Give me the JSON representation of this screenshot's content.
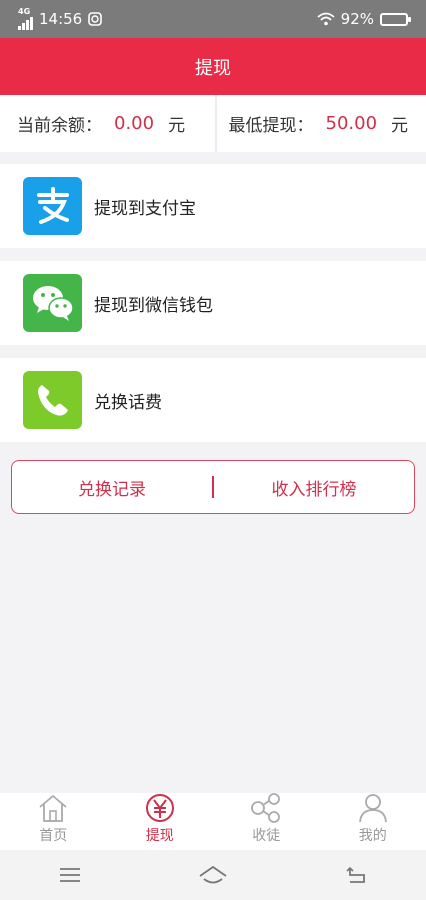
{
  "status_bar": {
    "network": "4G",
    "time": "14:56",
    "battery": "92%",
    "battery_level": 0.92
  },
  "header": {
    "title": "提现"
  },
  "balance": {
    "current_label": "当前余额：",
    "current_value": "0.00",
    "current_unit": "元",
    "min_label": "最低提现：",
    "min_value": "50.00",
    "min_unit": "元"
  },
  "options": [
    {
      "label": "提现到支付宝",
      "icon": "alipay-icon",
      "color": "#1aa0e8"
    },
    {
      "label": "提现到微信钱包",
      "icon": "wechat-icon",
      "color": "#44b549"
    },
    {
      "label": "兑换话费",
      "icon": "phone-icon",
      "color": "#7ccb2b"
    }
  ],
  "links": {
    "records": "兑换记录",
    "ranking": "收入排行榜"
  },
  "tabs": [
    {
      "label": "首页",
      "icon": "home-icon"
    },
    {
      "label": "提现",
      "icon": "yen-icon",
      "active": true
    },
    {
      "label": "收徒",
      "icon": "share-icon"
    },
    {
      "label": "我的",
      "icon": "user-icon"
    }
  ],
  "colors": {
    "accent": "#ea2b47",
    "value_red": "#d0304b"
  }
}
